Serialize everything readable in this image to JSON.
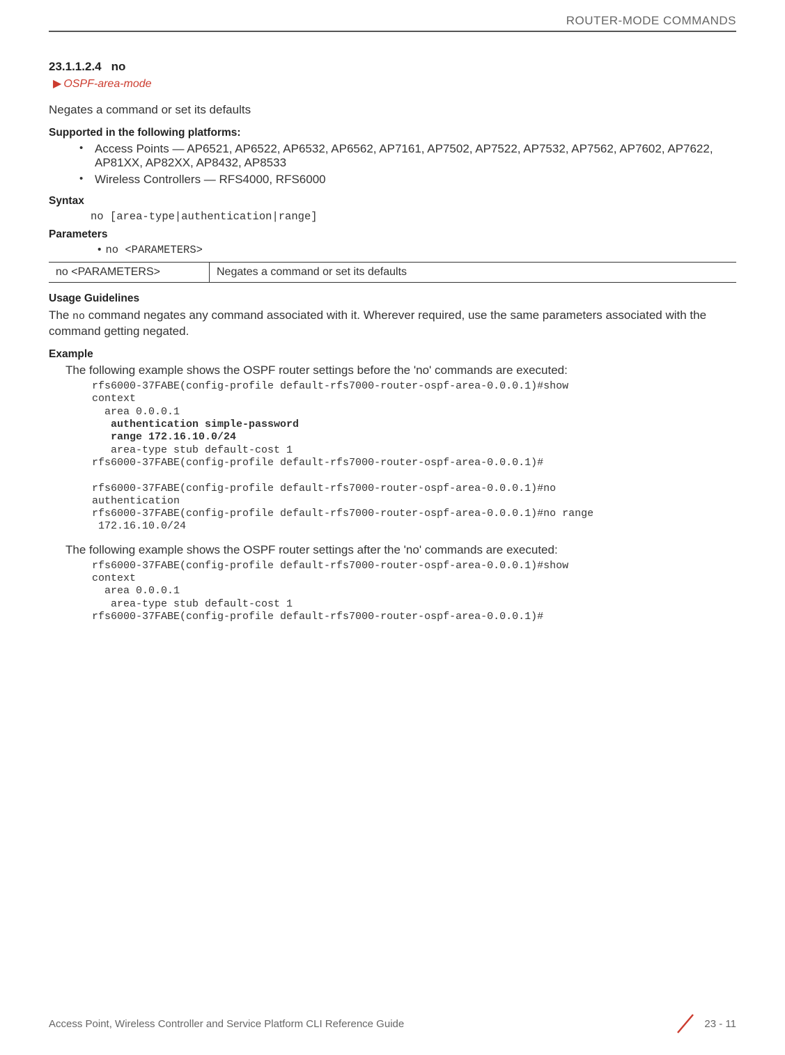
{
  "header": {
    "running_title": "ROUTER-MODE COMMANDS"
  },
  "section": {
    "number": "23.1.1.2.4",
    "title": "no",
    "breadcrumb": "OSPF-area-mode",
    "description": "Negates a command or set its defaults"
  },
  "supported": {
    "heading": "Supported in the following platforms:",
    "items": [
      "Access Points — AP6521, AP6522, AP6532, AP6562, AP7161, AP7502, AP7522, AP7532, AP7562, AP7602, AP7622, AP81XX, AP82XX, AP8432, AP8533",
      "Wireless Controllers — RFS4000, RFS6000"
    ]
  },
  "syntax": {
    "heading": "Syntax",
    "code": "no [area-type|authentication|range]"
  },
  "parameters": {
    "heading": "Parameters",
    "item": "no <PARAMETERS>",
    "table": {
      "left": "no <PARAMETERS>",
      "right": "Negates a command or set its defaults"
    }
  },
  "usage": {
    "heading": "Usage Guidelines",
    "text_before": "The ",
    "code_inline": "no",
    "text_after": " command negates any command associated with it. Wherever required, use the same parameters associated with the command getting negated."
  },
  "example": {
    "heading": "Example",
    "intro1": "The following example shows the OSPF router settings before the 'no' commands are executed:",
    "cli1_line1": "rfs6000-37FABE(config-profile default-rfs7000-router-ospf-area-0.0.0.1)#show ",
    "cli1_line2": "context",
    "cli1_line3": "  area 0.0.0.1",
    "cli1_line4_bold": "   authentication simple-password",
    "cli1_line5_bold": "   range 172.16.10.0/24",
    "cli1_line6": "   area-type stub default-cost 1",
    "cli1_line7": "rfs6000-37FABE(config-profile default-rfs7000-router-ospf-area-0.0.0.1)#",
    "cli1_line8": "",
    "cli1_line9": "rfs6000-37FABE(config-profile default-rfs7000-router-ospf-area-0.0.0.1)#no ",
    "cli1_line10": "authentication",
    "cli1_line11": "rfs6000-37FABE(config-profile default-rfs7000-router-ospf-area-0.0.0.1)#no range",
    "cli1_line12": " 172.16.10.0/24",
    "intro2": "The following example shows the OSPF router settings after the 'no' commands are executed:",
    "cli2_line1": "rfs6000-37FABE(config-profile default-rfs7000-router-ospf-area-0.0.0.1)#show ",
    "cli2_line2": "context",
    "cli2_line3": "  area 0.0.0.1",
    "cli2_line4": "   area-type stub default-cost 1",
    "cli2_line5": "rfs6000-37FABE(config-profile default-rfs7000-router-ospf-area-0.0.0.1)#"
  },
  "footer": {
    "guide": "Access Point, Wireless Controller and Service Platform CLI Reference Guide",
    "page": "23 - 11"
  }
}
